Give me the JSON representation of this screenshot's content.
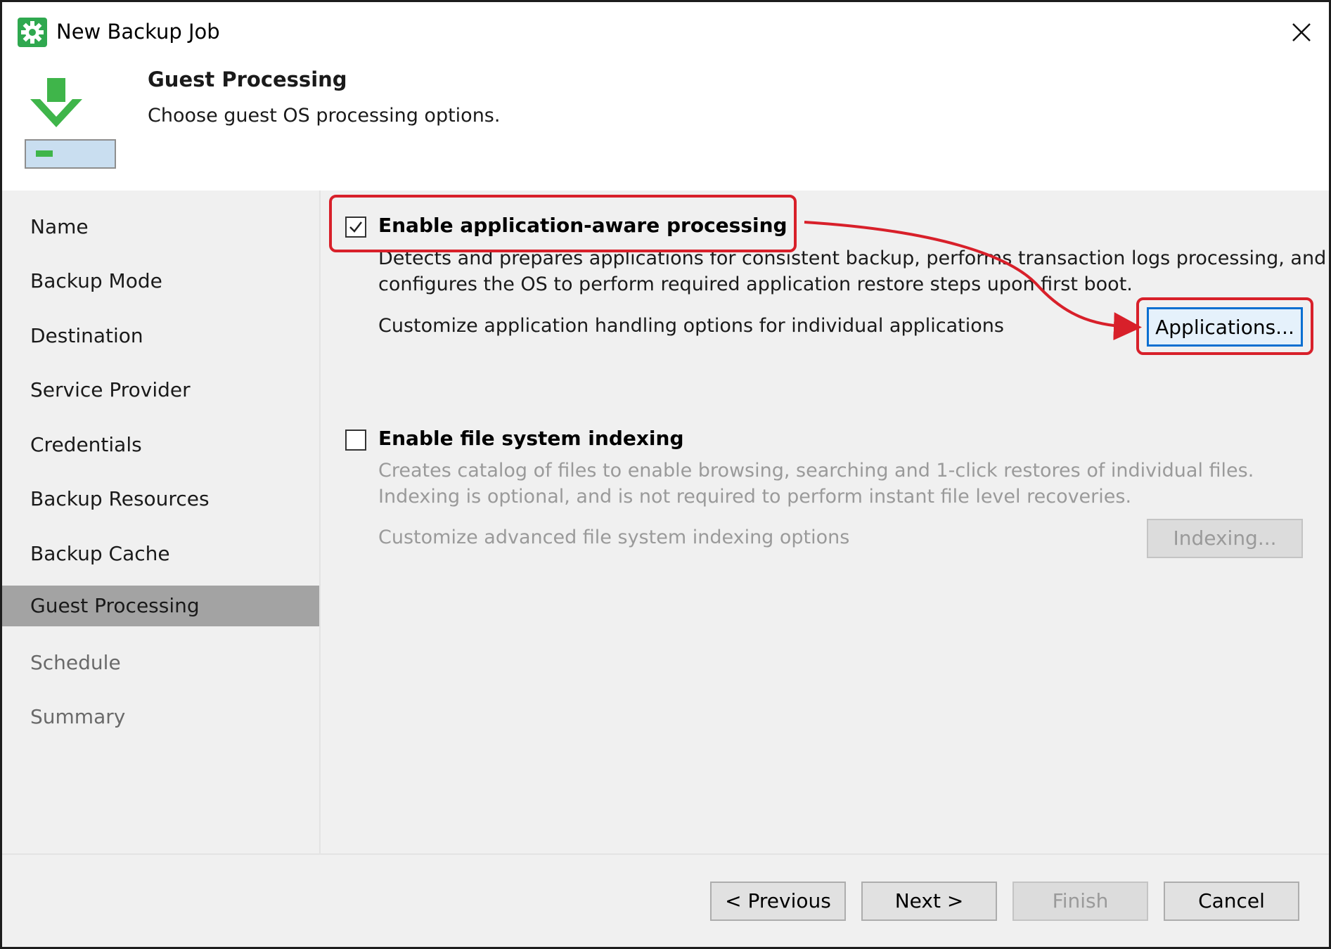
{
  "window": {
    "title": "New Backup Job",
    "close_symbol": "✕"
  },
  "header": {
    "title": "Guest Processing",
    "subtitle": "Choose guest OS processing options."
  },
  "sidebar": {
    "items": [
      {
        "label": "Name",
        "state": "completed"
      },
      {
        "label": "Backup Mode",
        "state": "completed"
      },
      {
        "label": "Destination",
        "state": "completed"
      },
      {
        "label": "Service Provider",
        "state": "completed"
      },
      {
        "label": "Credentials",
        "state": "completed"
      },
      {
        "label": "Backup Resources",
        "state": "completed"
      },
      {
        "label": "Backup Cache",
        "state": "completed"
      },
      {
        "label": "Guest Processing",
        "state": "active"
      },
      {
        "label": "Schedule",
        "state": "future"
      },
      {
        "label": "Summary",
        "state": "future"
      }
    ]
  },
  "app_aware": {
    "checked": true,
    "label": "Enable application-aware processing",
    "desc_line1": "Detects and prepares applications for consistent backup, performs transaction logs processing, and",
    "desc_line2": "configures the OS to perform required application restore steps upon first boot.",
    "customize_text": "Customize application handling options for individual applications",
    "button_label": "Applications..."
  },
  "indexing": {
    "checked": false,
    "label": "Enable file system indexing",
    "desc_line1": "Creates catalog of files to enable browsing, searching and 1-click restores of individual files.",
    "desc_line2": "Indexing is optional, and is not required to perform instant file level recoveries.",
    "customize_text": "Customize advanced file system indexing options",
    "button_label": "Indexing..."
  },
  "footer": {
    "previous_label": "< Previous",
    "next_label": "Next >",
    "finish_label": "Finish",
    "cancel_label": "Cancel"
  },
  "colors": {
    "annotation_red": "#d8202a",
    "focus_blue": "#0a6fd1",
    "app_icon_green": "#2fa84f"
  },
  "icons": {
    "title_icon": "gear-icon",
    "wizard_icon": "backup-download-icon",
    "close_icon": "close-icon",
    "check_icon": "checkmark-icon"
  }
}
